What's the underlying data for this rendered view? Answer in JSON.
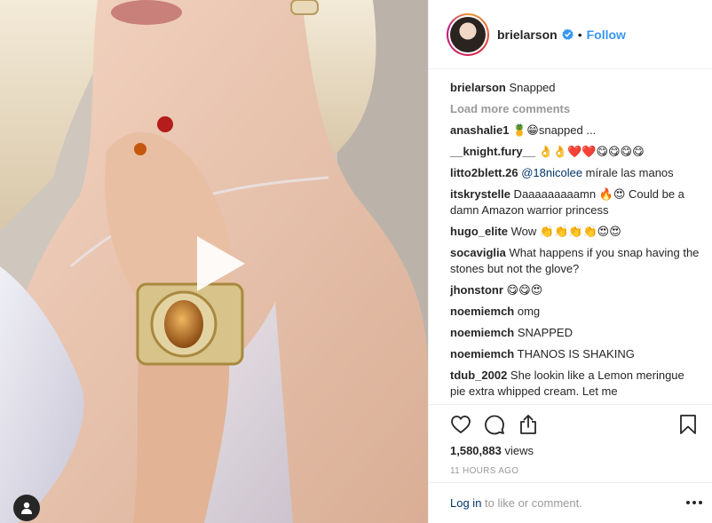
{
  "post": {
    "author": "brielarson",
    "follow_label": "Follow",
    "dot": "•",
    "caption_user": "brielarson",
    "caption_text": "Snapped",
    "load_more": "Load more comments",
    "views_count": "1,580,883",
    "views_label": " views",
    "timestamp": "11 HOURS AGO",
    "login_link": "Log in",
    "login_rest": " to like or comment."
  },
  "comments": [
    {
      "user": "anashalie1",
      "text": " 🍍😁snapped ..."
    },
    {
      "user": "__knight.fury__",
      "text": " 👌👌❤️❤️😋😋😋😋"
    },
    {
      "user": "litto2blett.26",
      "mention": "@18nicolee",
      "text": " mírale las manos"
    },
    {
      "user": "itskrystelle",
      "text": " Daaaaaaaaamn 🔥😍 Could be a damn Amazon warrior princess"
    },
    {
      "user": "hugo_elite",
      "text": " Wow 👏👏👏👏😍😍"
    },
    {
      "user": "socaviglia",
      "text": " What happens if you snap having the stones but not the glove?"
    },
    {
      "user": "jhonstonr",
      "text": " 😋😋😍"
    },
    {
      "user": "noemiemch",
      "text": " omg"
    },
    {
      "user": "noemiemch",
      "text": " SNAPPED"
    },
    {
      "user": "noemiemch",
      "text": " THANOS IS SHAKING"
    },
    {
      "user": "tdub_2002",
      "text": " She lookin like a Lemon meringue pie extra whipped cream. Let me"
    }
  ],
  "icons": {
    "play": "play-icon",
    "user_tag": "user-tag-icon",
    "verified": "verified-badge-icon",
    "heart": "heart-icon",
    "comment": "comment-icon",
    "share": "share-icon",
    "bookmark": "bookmark-icon",
    "more": "more-options-icon"
  },
  "colors": {
    "link_blue": "#3897f0",
    "mention_navy": "#003569",
    "muted_gray": "#999999",
    "text_dark": "#262626"
  }
}
